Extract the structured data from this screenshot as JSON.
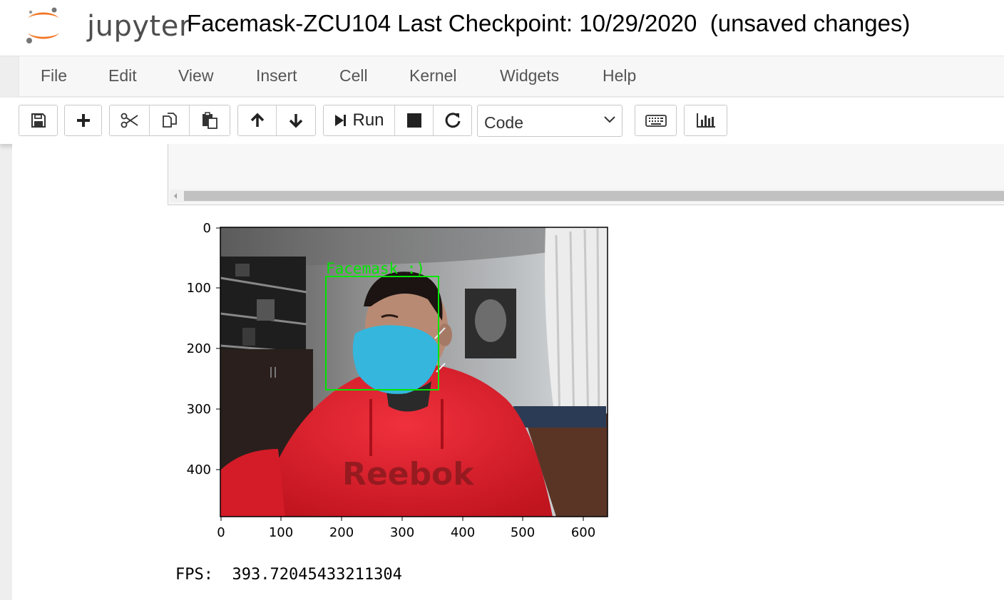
{
  "header": {
    "logo_text": "jupyter",
    "notebook_title": "Facemask-ZCU104",
    "checkpoint": "Last Checkpoint: 10/29/2020",
    "save_status": "(unsaved changes)"
  },
  "menubar": {
    "items": [
      "File",
      "Edit",
      "View",
      "Insert",
      "Cell",
      "Kernel",
      "Widgets",
      "Help"
    ]
  },
  "toolbar": {
    "icons": [
      "save-icon",
      "plus-icon",
      "scissors-icon",
      "copy-icon",
      "paste-icon",
      "arrow-up-icon",
      "arrow-down-icon",
      "run-icon",
      "stop-icon",
      "restart-icon",
      "keyboard-icon",
      "bar-chart-icon"
    ],
    "run_label": "Run",
    "cell_type": "Code"
  },
  "output": {
    "plot": {
      "x_ticks": [
        "0",
        "100",
        "200",
        "300",
        "400",
        "500",
        "600"
      ],
      "y_ticks": [
        "0",
        "100",
        "200",
        "300",
        "400"
      ],
      "detection_label": "Facemask :)",
      "box_color": "#00e600",
      "image_description": "webcam frame, person in red Reebok hoodie wearing blue face mask"
    },
    "fps_label": "FPS:",
    "fps_value": "393.72045433211304"
  },
  "colors": {
    "accent_orange": "#f37726",
    "menu_text": "#555555"
  }
}
